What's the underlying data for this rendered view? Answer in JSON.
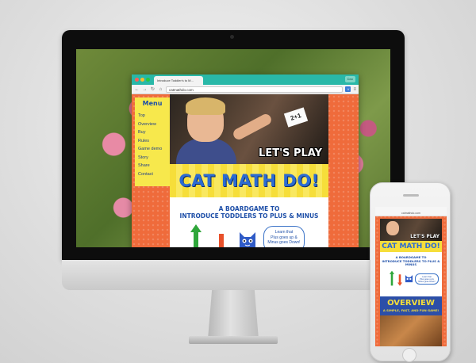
{
  "browser": {
    "tab_title": "Introduce Toddler's to M...",
    "url": "catmathdo.com",
    "profile": "Dao",
    "extension_icon": "V"
  },
  "site": {
    "menu_title": "Menu",
    "menu_items": [
      "Top",
      "Overview",
      "Buy",
      "Rules",
      "Game demo",
      "Story",
      "Share",
      "Contact"
    ],
    "card_text": "2+1",
    "lets_play": "LET'S PLAY",
    "title": "CAT MATH DO!",
    "tagline_line1": "A BOARDGAME TO",
    "tagline_line2": "INTRODUCE TODDLERS TO PLUS & MINUS",
    "speech_lines": [
      "Learn that",
      "Plus goes up &",
      "Minus goes Down!"
    ]
  },
  "phone": {
    "lets_play": "LET'S PLAY",
    "title": "CAT MATH DO!",
    "tagline_line1": "A BOARDGAME TO",
    "tagline_line2": "INTRODUCE TODDLERS TO PLUS & MINUS",
    "speech_lines": [
      "Learn that",
      "Plus goes up &",
      "Minus goes Down!"
    ],
    "overview_heading": "OVERVIEW",
    "overview_sub": "A SIMPLE, FAST, AND FUN GAME!"
  },
  "colors": {
    "site_orange": "#ef6b3b",
    "menu_yellow": "#f7e84c",
    "title_blue": "#2c6bd2",
    "browser_teal": "#29b8a8"
  }
}
